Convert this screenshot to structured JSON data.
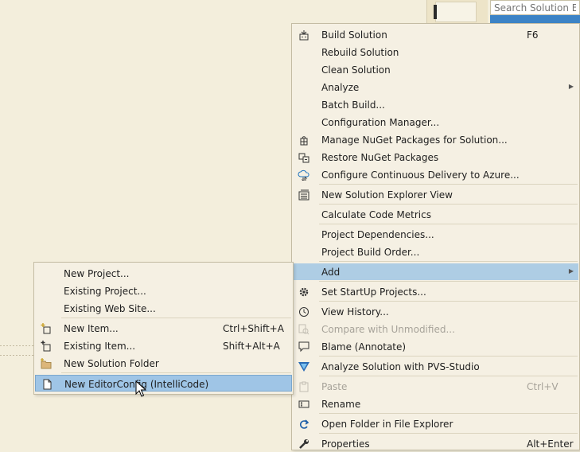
{
  "search": {
    "placeholder": "Search Solution Expl"
  },
  "context_menu": {
    "build_solution": {
      "label": "Build Solution",
      "shortcut": "F6"
    },
    "rebuild_solution": "Rebuild Solution",
    "clean_solution": "Clean Solution",
    "analyze": "Analyze",
    "batch_build": "Batch Build...",
    "configuration_manager": "Configuration Manager...",
    "manage_nuget": "Manage NuGet Packages for Solution...",
    "restore_nuget": "Restore NuGet Packages",
    "configure_cd": "Configure Continuous Delivery to Azure...",
    "new_solution_explorer_view": "New Solution Explorer View",
    "calculate_code_metrics": "Calculate Code Metrics",
    "project_dependencies": "Project Dependencies...",
    "project_build_order": "Project Build Order...",
    "add": "Add",
    "set_startup_projects": "Set StartUp Projects...",
    "view_history": "View History...",
    "compare_unmodified": "Compare with Unmodified...",
    "blame": "Blame (Annotate)",
    "pvs_studio": "Analyze Solution with PVS-Studio",
    "paste": {
      "label": "Paste",
      "shortcut": "Ctrl+V"
    },
    "rename": "Rename",
    "open_folder": "Open Folder in File Explorer",
    "properties": {
      "label": "Properties",
      "shortcut": "Alt+Enter"
    }
  },
  "add_submenu": {
    "new_project": "New Project...",
    "existing_project": "Existing Project...",
    "existing_web_site": "Existing Web Site...",
    "new_item": {
      "label": "New Item...",
      "shortcut": "Ctrl+Shift+A"
    },
    "existing_item": {
      "label": "Existing Item...",
      "shortcut": "Shift+Alt+A"
    },
    "new_solution_folder": "New Solution Folder",
    "new_editorconfig": "New EditorConfig (IntelliCode)"
  },
  "colors": {
    "background": "#f3eedc",
    "menu_background": "#f5f0e3",
    "highlight": "#aecde4",
    "disabled_text": "#a7a39a"
  }
}
